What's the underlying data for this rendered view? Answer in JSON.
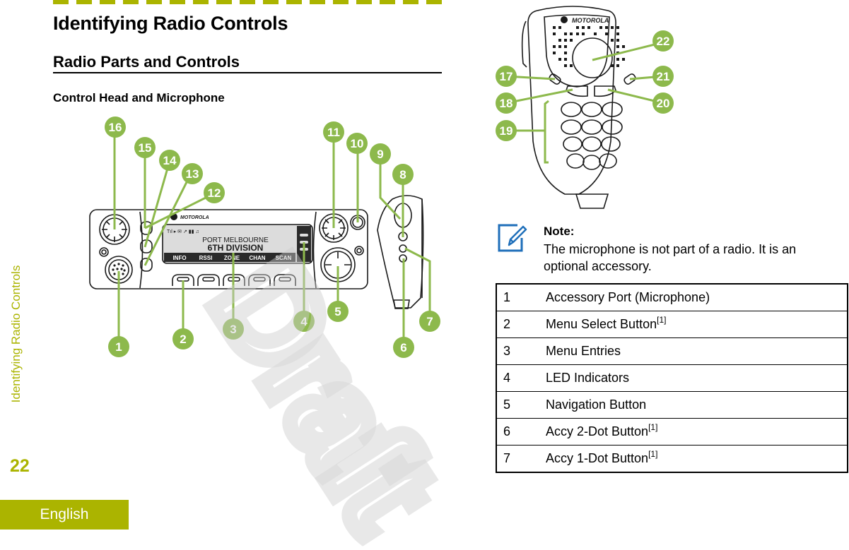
{
  "page": {
    "heading1": "Identifying Radio Controls",
    "heading2": "Radio Parts and Controls",
    "heading3": "Control Head and Microphone",
    "side_label": "Identifying Radio Controls",
    "page_number": "22",
    "language_tab": "English",
    "watermark": "Draft",
    "accent_color": "#abb400",
    "callout_color": "#8db94c"
  },
  "control_head": {
    "brand": "MOTOROLA",
    "display_line1": "PORT MELBOURNE",
    "display_line2": "6TH DIVISION",
    "status_icons": "Tıl ▸ ✉ ↗ ▮▮ ♫",
    "softkeys": [
      "INFO",
      "RSSI",
      "ZONE",
      "CHAN",
      "SCAN"
    ]
  },
  "microphone": {
    "brand": "MOTOROLA"
  },
  "callouts": [
    "1",
    "2",
    "3",
    "4",
    "5",
    "6",
    "7",
    "8",
    "9",
    "10",
    "11",
    "12",
    "13",
    "14",
    "15",
    "16",
    "17",
    "18",
    "19",
    "20",
    "21",
    "22"
  ],
  "note": {
    "title": "Note:",
    "body": "The microphone is not part of a radio. It is an optional accessory."
  },
  "legend": [
    {
      "num": "1",
      "label": "Accessory Port (Microphone)",
      "footnote": ""
    },
    {
      "num": "2",
      "label": "Menu Select Button",
      "footnote": "[1]"
    },
    {
      "num": "3",
      "label": "Menu Entries",
      "footnote": ""
    },
    {
      "num": "4",
      "label": "LED Indicators",
      "footnote": ""
    },
    {
      "num": "5",
      "label": "Navigation Button",
      "footnote": ""
    },
    {
      "num": "6",
      "label": "Accy 2-Dot Button",
      "footnote": "[1]"
    },
    {
      "num": "7",
      "label": "Accy 1-Dot Button",
      "footnote": "[1]"
    }
  ]
}
